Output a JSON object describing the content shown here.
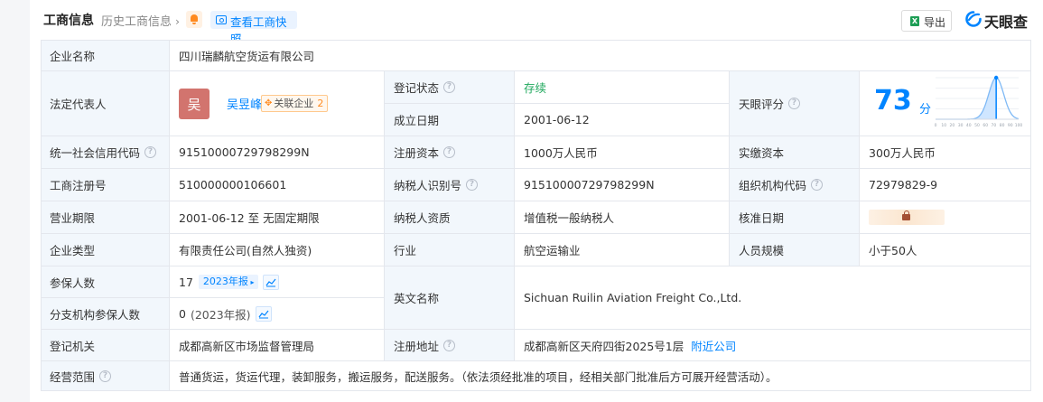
{
  "header": {
    "title": "工商信息",
    "history_link": "历史工商信息",
    "snapshot_button": "查看工商快照",
    "export_button": "导出",
    "export_icon_text": "X",
    "logo_text": "天眼查"
  },
  "company": {
    "name_label": "企业名称",
    "name_value": "四川瑞麟航空货运有限公司",
    "legal_rep_label": "法定代表人",
    "legal_rep_avatar": "吴",
    "legal_rep_name": "吴昱峰",
    "related_label": "关联企业",
    "related_count": "2",
    "reg_status_label": "登记状态",
    "reg_status_value": "存续",
    "found_date_label": "成立日期",
    "found_date_value": "2001-06-12",
    "score_label": "天眼评分",
    "score_value": "73",
    "score_unit": "分",
    "uscc_label": "统一社会信用代码",
    "uscc_value": "91510000729798299N",
    "reg_capital_label": "注册资本",
    "reg_capital_value": "1000万人民币",
    "paid_capital_label": "实缴资本",
    "paid_capital_value": "300万人民币",
    "biz_reg_no_label": "工商注册号",
    "biz_reg_no_value": "510000000106601",
    "taxpayer_id_label": "纳税人识别号",
    "taxpayer_id_value": "91510000729798299N",
    "org_code_label": "组织机构代码",
    "org_code_value": "72979829-9",
    "biz_term_label": "营业期限",
    "biz_term_value": "2001-06-12 至 无固定期限",
    "taxpayer_qual_label": "纳税人资质",
    "taxpayer_qual_value": "增值税一般纳税人",
    "approval_date_label": "核准日期",
    "type_label": "企业类型",
    "type_value": "有限责任公司(自然人独资)",
    "industry_label": "行业",
    "industry_value": "航空运输业",
    "staff_size_label": "人员规模",
    "staff_size_value": "小于50人",
    "insured_label": "参保人数",
    "insured_value": "17",
    "insured_year_tag": "2023年报",
    "branch_insured_label": "分支机构参保人数",
    "branch_insured_value": "0",
    "branch_insured_year": "(2023年报)",
    "english_name_label": "英文名称",
    "english_name_value": "Sichuan Ruilin Aviation Freight Co.,Ltd.",
    "reg_authority_label": "登记机关",
    "reg_authority_value": "成都高新区市场监督管理局",
    "reg_address_label": "注册地址",
    "reg_address_value": "成都高新区天府四街2025号1层",
    "nearby_link": "附近公司",
    "scope_label": "经营范围",
    "scope_value": "普通货运，货运代理，装卸服务，搬运服务，配送服务。（依法须经批准的项目，经相关部门批准后方可展开经营活动）。"
  },
  "score_axis_ticks": [
    "0",
    "5",
    "10",
    "15",
    "20",
    "25",
    "30",
    "35",
    "40",
    "45",
    "50",
    "55",
    "60",
    "65",
    "70",
    "75",
    "80",
    "85",
    "90",
    "95",
    "100"
  ],
  "score_marker": 73,
  "icons": {
    "bell": "bell-icon",
    "camera": "camera-icon",
    "excel": "excel-icon",
    "logo": "tianyancha-logo-icon",
    "help": "question-circle-icon",
    "trend": "trend-chart-icon",
    "lock": "lock-icon"
  },
  "colors": {
    "accent": "#0084ff",
    "status_green": "#1fa85d",
    "label_bg": "#f2f7fc",
    "avatar_bg": "#d2746e",
    "tag_orange": "#ff8a1f"
  }
}
